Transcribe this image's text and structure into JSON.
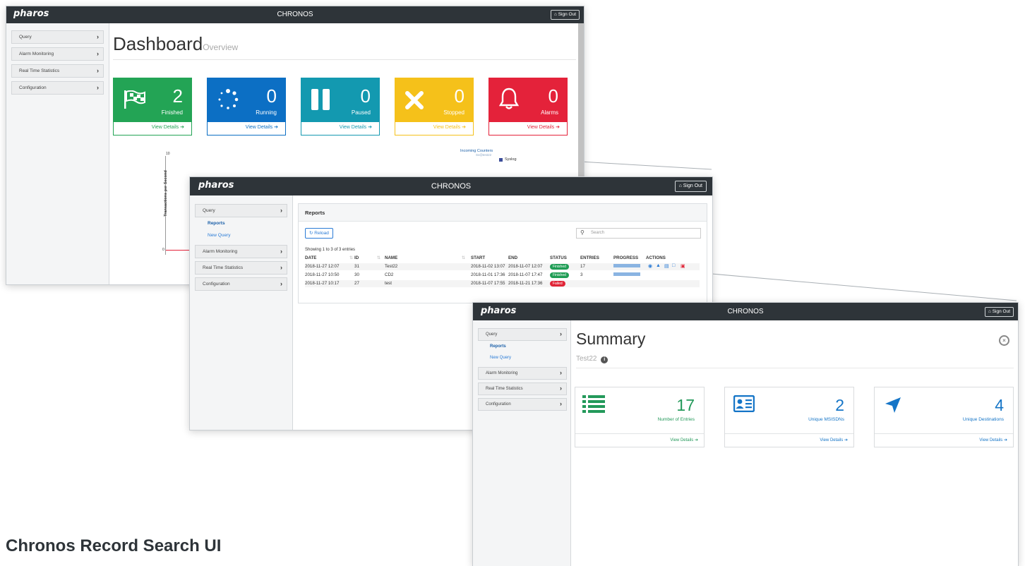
{
  "app": {
    "logo": "pharos",
    "title": "CHRONOS",
    "sign_out": "Sign Out",
    "home_icon": "home-icon"
  },
  "sidebar": {
    "items": [
      {
        "label": "Query",
        "sub": [
          "Reports",
          "New Query"
        ]
      },
      {
        "label": "Alarm Monitoring"
      },
      {
        "label": "Real Time Statistics"
      },
      {
        "label": "Configuration"
      }
    ]
  },
  "dashboard": {
    "title": "Dashboard",
    "subtitle": "Overview",
    "cards": [
      {
        "value": "2",
        "label": "Finished",
        "details": "View Details",
        "color": "#23a455",
        "icon": "checkered-flag-icon"
      },
      {
        "value": "0",
        "label": "Running",
        "details": "View Details",
        "color": "#0c6fc4",
        "icon": "spinner-icon"
      },
      {
        "value": "0",
        "label": "Paused",
        "details": "View Details",
        "color": "#1399b0",
        "icon": "pause-icon"
      },
      {
        "value": "0",
        "label": "Stopped",
        "details": "View Details",
        "color": "#f5c11a",
        "icon": "stop-x-icon"
      },
      {
        "value": "0",
        "label": "Alarms",
        "details": "View Details",
        "color": "#e4223a",
        "icon": "bell-icon"
      }
    ],
    "chart": {
      "ylabel": "Transactions per Second",
      "ytick_top": "10",
      "ytick_bottom": "0",
      "title": "Incoming Counters",
      "subtitle": "Sv@test22",
      "legend": "Syslog"
    }
  },
  "reports": {
    "title": "Reports",
    "reload": "Reload",
    "search_placeholder": "Search",
    "showing": "Showing 1 to 3 of 3 entries",
    "columns": [
      "DATE",
      "ID",
      "NAME",
      "START",
      "END",
      "STATUS",
      "ENTRIES",
      "PROGRESS",
      "ACTIONS"
    ],
    "rows": [
      {
        "date": "2018-11-27 12:07",
        "id": "31",
        "name": "Test22",
        "start": "2018-11-02 13:07",
        "end": "2018-11-07 12:07",
        "status": "Finished",
        "entries": "17",
        "progress": 1.0
      },
      {
        "date": "2018-11-27 10:50",
        "id": "30",
        "name": "CD2",
        "start": "2018-11-01 17:36",
        "end": "2018-11-07 17:47",
        "status": "Finished",
        "entries": "3",
        "progress": 1.0
      },
      {
        "date": "2018-11-27 10:17",
        "id": "27",
        "name": "test",
        "start": "2018-11-07 17:55",
        "end": "2018-11-21 17:36",
        "status": "Failed",
        "entries": "",
        "progress": 0
      }
    ],
    "status_colors": {
      "Finished": "#1f9d55",
      "Failed": "#e02436"
    }
  },
  "summary": {
    "title": "Summary",
    "subtitle": "Test22",
    "cards": [
      {
        "value": "17",
        "label": "Number of Entries",
        "details": "View Details",
        "icon": "list-icon",
        "color": "#23995a"
      },
      {
        "value": "2",
        "label": "Unique MSISDNs",
        "details": "View Details",
        "icon": "id-card-icon",
        "color": "#1575c7"
      },
      {
        "value": "4",
        "label": "Unique Destinations",
        "details": "View Details",
        "icon": "location-arrow-icon",
        "color": "#1575c7"
      }
    ]
  },
  "caption": "Chronos Record Search UI"
}
